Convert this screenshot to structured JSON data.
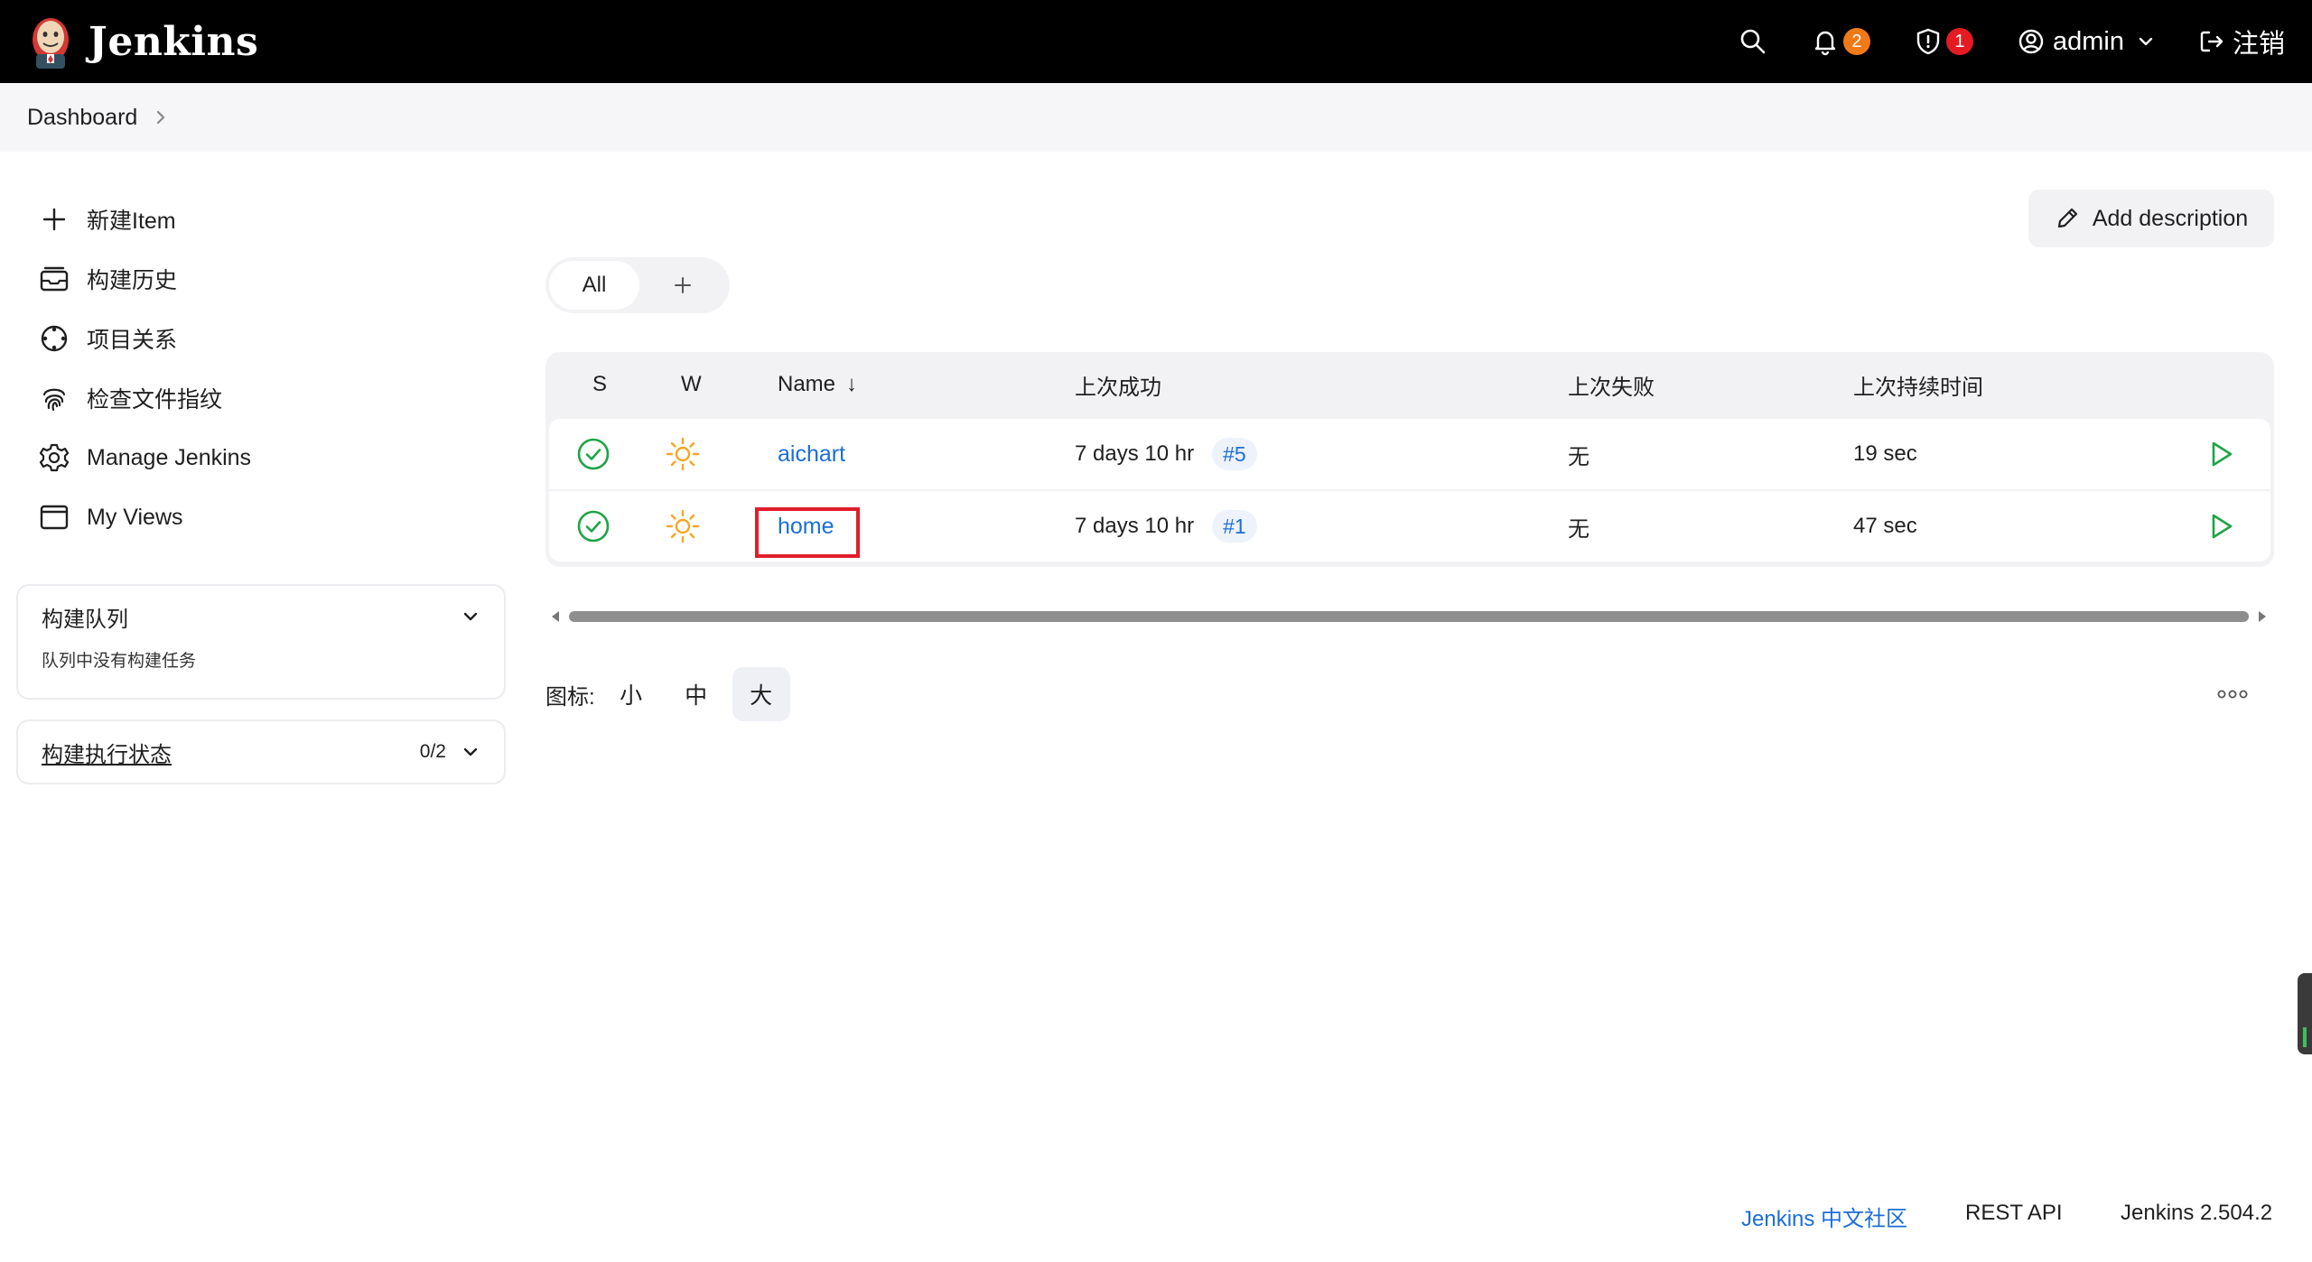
{
  "header": {
    "brand": "Jenkins",
    "notifications_count": "2",
    "security_count": "1",
    "user": "admin",
    "logout": "注销"
  },
  "breadcrumb": {
    "items": [
      "Dashboard"
    ]
  },
  "sidebar": {
    "tasks": [
      {
        "label": "新建Item",
        "icon": "plus-icon"
      },
      {
        "label": "构建历史",
        "icon": "history-icon"
      },
      {
        "label": "项目关系",
        "icon": "relationship-icon"
      },
      {
        "label": "检查文件指纹",
        "icon": "fingerprint-icon"
      },
      {
        "label": "Manage Jenkins",
        "icon": "gear-icon"
      },
      {
        "label": "My Views",
        "icon": "window-icon"
      }
    ],
    "build_queue": {
      "title": "构建队列",
      "empty_text": "队列中没有构建任务"
    },
    "executors": {
      "title": "构建执行状态",
      "count": "0/2"
    }
  },
  "main": {
    "add_description": "Add description",
    "tabs": [
      {
        "label": "All"
      }
    ],
    "table": {
      "headers": {
        "s": "S",
        "w": "W",
        "name": "Name",
        "sort_arrow": "↓",
        "last_success": "上次成功",
        "last_failure": "上次失败",
        "last_duration": "上次持续时间"
      },
      "rows": [
        {
          "name": "aichart",
          "last_success": "7 days 10 hr",
          "build": "#5",
          "last_failure": "无",
          "duration": "19 sec"
        },
        {
          "name": "home",
          "last_success": "7 days 10 hr",
          "build": "#1",
          "last_failure": "无",
          "duration": "47 sec"
        }
      ]
    },
    "icon_size": {
      "label": "图标:",
      "options": [
        "小",
        "中",
        "大"
      ],
      "selected": "大"
    }
  },
  "footer": {
    "community": "Jenkins 中文社区",
    "rest_api": "REST API",
    "version": "Jenkins 2.504.2"
  },
  "colors": {
    "header_bg": "#000000",
    "link": "#1a6ed8",
    "success": "#1ea446",
    "weather": "#f5a623",
    "highlight": "#e11d2a"
  }
}
